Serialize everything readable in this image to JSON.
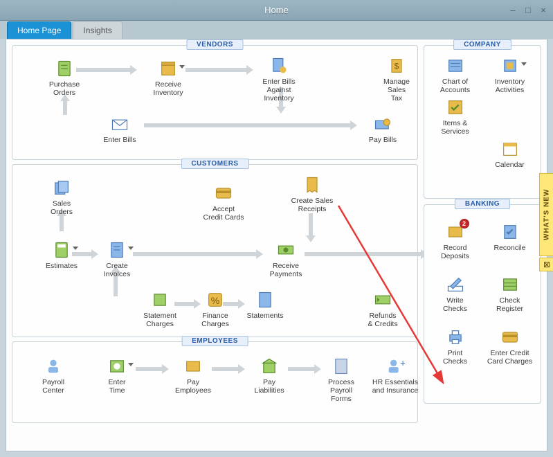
{
  "window": {
    "title": "Home"
  },
  "tabs": {
    "home": "Home Page",
    "insights": "Insights"
  },
  "sections": {
    "vendors": "VENDORS",
    "customers": "CUSTOMERS",
    "employees": "EMPLOYEES",
    "company": "COMPANY",
    "banking": "BANKING"
  },
  "vendors": {
    "purchase_orders": "Purchase\nOrders",
    "receive_inventory": "Receive\nInventory",
    "enter_bills_against_inventory": "Enter Bills\nAgainst\nInventory",
    "manage_sales_tax": "Manage\nSales\nTax",
    "enter_bills": "Enter Bills",
    "pay_bills": "Pay Bills"
  },
  "customers": {
    "sales_orders": "Sales\nOrders",
    "estimates": "Estimates",
    "create_invoices": "Create\nInvoices",
    "accept_credit_cards": "Accept\nCredit Cards",
    "create_sales_receipts": "Create Sales\nReceipts",
    "receive_payments": "Receive\nPayments",
    "statement_charges": "Statement\nCharges",
    "finance_charges": "Finance\nCharges",
    "statements": "Statements",
    "refunds_credits": "Refunds\n& Credits"
  },
  "employees": {
    "payroll_center": "Payroll\nCenter",
    "enter_time": "Enter\nTime",
    "pay_employees": "Pay\nEmployees",
    "pay_liabilities": "Pay\nLiabilities",
    "process_payroll_forms": "Process\nPayroll\nForms",
    "hr_essentials": "HR Essentials\nand Insurance"
  },
  "company": {
    "chart_of_accounts": "Chart of\nAccounts",
    "inventory_activities": "Inventory\nActivities",
    "items_services": "Items &\nServices",
    "calendar": "Calendar"
  },
  "banking": {
    "record_deposits": "Record\nDeposits",
    "record_deposits_badge": "2",
    "reconcile": "Reconcile",
    "write_checks": "Write\nChecks",
    "check_register": "Check\nRegister",
    "print_checks": "Print\nChecks",
    "enter_credit_card_charges": "Enter Credit\nCard Charges"
  },
  "sidebar": {
    "whats_new": "WHAT'S NEW"
  }
}
